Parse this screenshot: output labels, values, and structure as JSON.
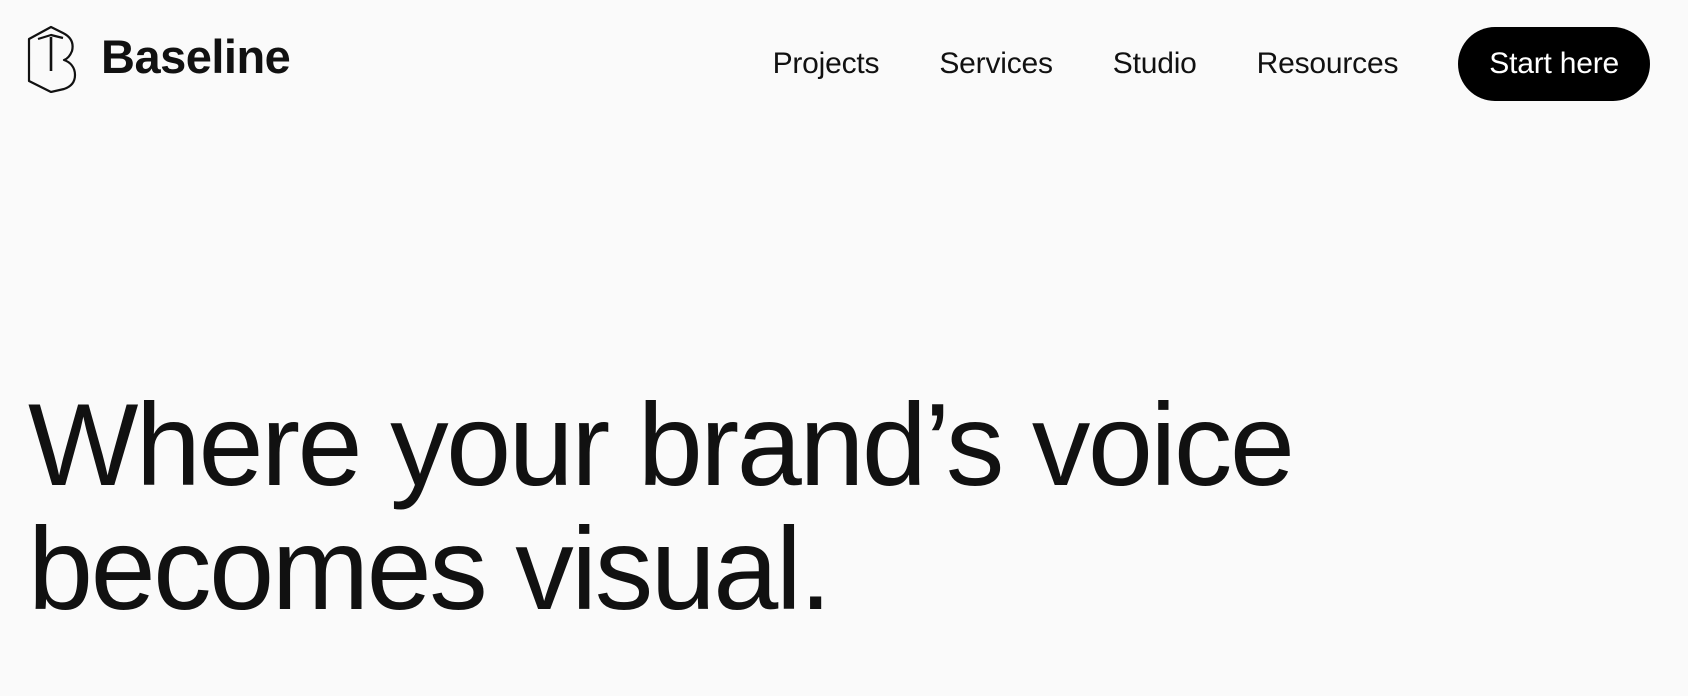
{
  "brand": {
    "name": "Baseline",
    "logo_icon": "hexagon-b-logo-icon"
  },
  "nav": {
    "items": [
      {
        "label": "Projects"
      },
      {
        "label": "Services"
      },
      {
        "label": "Studio"
      },
      {
        "label": "Resources"
      }
    ],
    "cta_label": "Start here"
  },
  "hero": {
    "title_line_1": "Where your brand’s voice",
    "title_line_2": "becomes visual."
  },
  "colors": {
    "background": "#fafafa",
    "text": "#111111",
    "cta_background": "#000000",
    "cta_text": "#ffffff"
  }
}
